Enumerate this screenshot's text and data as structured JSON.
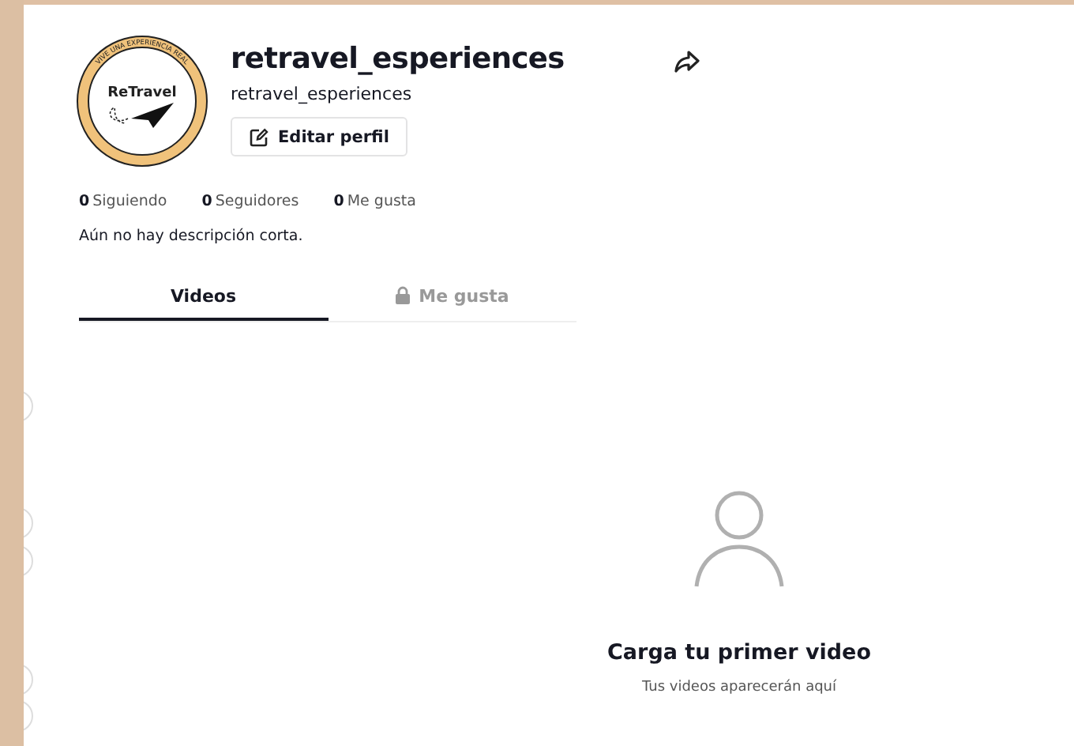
{
  "profile": {
    "logo_ring_text": "VIVE UNA EXPERIENCIA REAL",
    "logo_text": "ReTravel",
    "title": "retravel_esperiences",
    "handle": "retravel_esperiences",
    "edit_button": "Editar perfil"
  },
  "stats": [
    {
      "value": "0",
      "label": "Siguiendo"
    },
    {
      "value": "0",
      "label": "Seguidores"
    },
    {
      "value": "0",
      "label": "Me gusta"
    }
  ],
  "bio": "Aún no hay descripción corta.",
  "tabs": [
    {
      "label": "Videos",
      "selected": true,
      "locked": false
    },
    {
      "label": "Me gusta",
      "selected": false,
      "locked": true
    }
  ],
  "empty_state": {
    "title": "Carga tu primer video",
    "subtitle": "Tus videos aparecerán aquí"
  }
}
